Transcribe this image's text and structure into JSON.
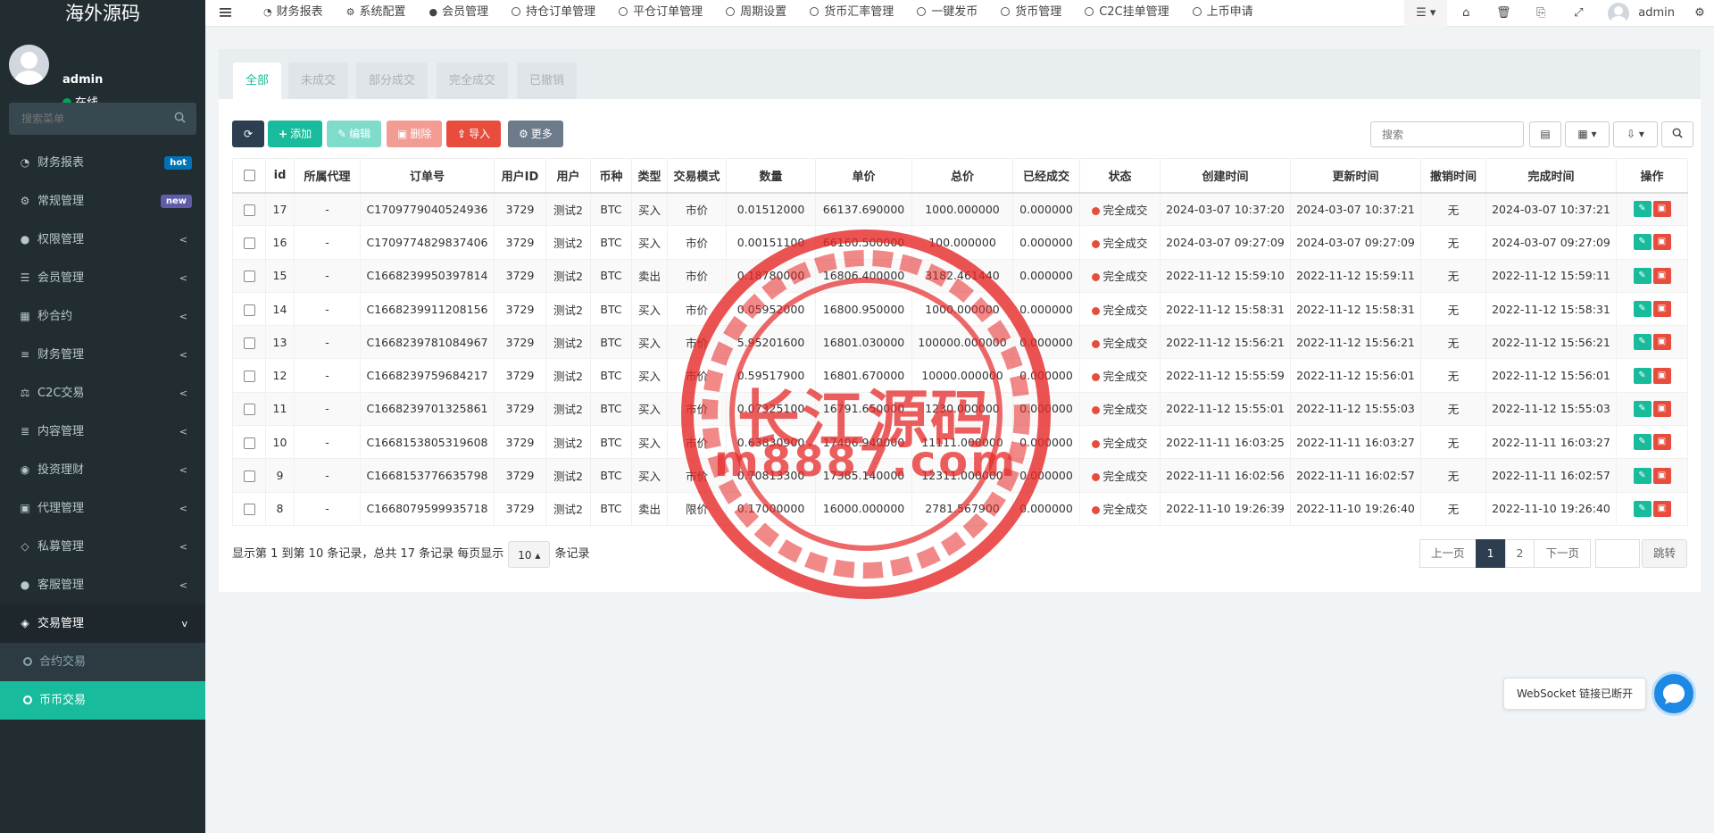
{
  "brand": "海外源码",
  "user": {
    "name": "admin",
    "status": "在线"
  },
  "sidebar": {
    "search_placeholder": "搜索菜单",
    "items": [
      {
        "label": "财务报表",
        "icon": "dashboard-icon",
        "badge": "hot"
      },
      {
        "label": "常规管理",
        "icon": "cogs-icon",
        "badge": "new"
      },
      {
        "label": "权限管理",
        "icon": "group-icon",
        "arrow": "<"
      },
      {
        "label": "会员管理",
        "icon": "list-icon",
        "arrow": "<"
      },
      {
        "label": "秒合约",
        "icon": "calendar-icon",
        "arrow": "<"
      },
      {
        "label": "财务管理",
        "icon": "database-icon",
        "arrow": "<"
      },
      {
        "label": "C2C交易",
        "icon": "balance-icon",
        "arrow": "<"
      },
      {
        "label": "内容管理",
        "icon": "align-left-icon",
        "arrow": "<"
      },
      {
        "label": "投资理财",
        "icon": "compass-icon",
        "arrow": "<"
      },
      {
        "label": "代理管理",
        "icon": "briefcase-icon",
        "arrow": "<"
      },
      {
        "label": "私募管理",
        "icon": "diamond-icon",
        "arrow": "<"
      },
      {
        "label": "客服管理",
        "icon": "comment-icon",
        "arrow": "<"
      },
      {
        "label": "交易管理",
        "icon": "handshake-icon",
        "arrow": "v"
      }
    ],
    "subitems": [
      {
        "label": "合约交易"
      },
      {
        "label": "币币交易"
      }
    ]
  },
  "header": {
    "tabs": [
      {
        "label": "财务报表",
        "icon": "dashboard-icon"
      },
      {
        "label": "系统配置",
        "icon": "gear-icon"
      },
      {
        "label": "会员管理",
        "icon": "user-icon"
      },
      {
        "label": "持仓订单管理",
        "icon": "circle-icon"
      },
      {
        "label": "平仓订单管理",
        "icon": "circle-icon"
      },
      {
        "label": "周期设置",
        "icon": "circle-icon"
      },
      {
        "label": "货币汇率管理",
        "icon": "circle-icon"
      },
      {
        "label": "一键发币",
        "icon": "circle-icon"
      },
      {
        "label": "货币管理",
        "icon": "circle-icon"
      },
      {
        "label": "C2C挂单管理",
        "icon": "circle-icon"
      },
      {
        "label": "上币申请",
        "icon": "circle-icon"
      }
    ],
    "user": "admin"
  },
  "filter_tabs": [
    "全部",
    "未成交",
    "部分成交",
    "完全成交",
    "已撤销"
  ],
  "toolbar": {
    "add": "添加",
    "edit": "编辑",
    "delete": "删除",
    "import": "导入",
    "more": "更多",
    "search_placeholder": "搜索"
  },
  "table": {
    "columns": [
      "id",
      "所属代理",
      "订单号",
      "用户ID",
      "用户",
      "币种",
      "类型",
      "交易模式",
      "数量",
      "单价",
      "总价",
      "已经成交",
      "状态",
      "创建时间",
      "更新时间",
      "撤销时间",
      "完成时间",
      "操作"
    ],
    "rows": [
      [
        "17",
        "-",
        "C1709779040524936",
        "3729",
        "测试2",
        "BTC",
        "买入",
        "市价",
        "0.01512000",
        "66137.690000",
        "1000.000000",
        "0.000000",
        "完全成交",
        "2024-03-07 10:37:20",
        "2024-03-07 10:37:21",
        "无",
        "2024-03-07 10:37:21"
      ],
      [
        "16",
        "-",
        "C1709774829837406",
        "3729",
        "测试2",
        "BTC",
        "买入",
        "市价",
        "0.00151100",
        "66160.500000",
        "100.000000",
        "0.000000",
        "完全成交",
        "2024-03-07 09:27:09",
        "2024-03-07 09:27:09",
        "无",
        "2024-03-07 09:27:09"
      ],
      [
        "15",
        "-",
        "C1668239950397814",
        "3729",
        "测试2",
        "BTC",
        "卖出",
        "市价",
        "0.18780000",
        "16806.400000",
        "3182.461440",
        "0.000000",
        "完全成交",
        "2022-11-12 15:59:10",
        "2022-11-12 15:59:11",
        "无",
        "2022-11-12 15:59:11"
      ],
      [
        "14",
        "-",
        "C1668239911208156",
        "3729",
        "测试2",
        "BTC",
        "买入",
        "市价",
        "0.05952000",
        "16800.950000",
        "1000.000000",
        "0.000000",
        "完全成交",
        "2022-11-12 15:58:31",
        "2022-11-12 15:58:31",
        "无",
        "2022-11-12 15:58:31"
      ],
      [
        "13",
        "-",
        "C1668239781084967",
        "3729",
        "测试2",
        "BTC",
        "买入",
        "市价",
        "5.95201600",
        "16801.030000",
        "100000.000000",
        "0.000000",
        "完全成交",
        "2022-11-12 15:56:21",
        "2022-11-12 15:56:21",
        "无",
        "2022-11-12 15:56:21"
      ],
      [
        "12",
        "-",
        "C1668239759684217",
        "3729",
        "测试2",
        "BTC",
        "买入",
        "市价",
        "0.59517900",
        "16801.670000",
        "10000.000000",
        "0.000000",
        "完全成交",
        "2022-11-12 15:55:59",
        "2022-11-12 15:56:01",
        "无",
        "2022-11-12 15:56:01"
      ],
      [
        "11",
        "-",
        "C1668239701325861",
        "3729",
        "测试2",
        "BTC",
        "买入",
        "市价",
        "0.07325100",
        "16791.650000",
        "1230.000000",
        "0.000000",
        "完全成交",
        "2022-11-12 15:55:01",
        "2022-11-12 15:55:03",
        "无",
        "2022-11-12 15:55:03"
      ],
      [
        "10",
        "-",
        "C1668153805319608",
        "3729",
        "测试2",
        "BTC",
        "买入",
        "市价",
        "0.63830900",
        "17406.940000",
        "11111.000000",
        "0.000000",
        "完全成交",
        "2022-11-11 16:03:25",
        "2022-11-11 16:03:27",
        "无",
        "2022-11-11 16:03:27"
      ],
      [
        "9",
        "-",
        "C1668153776635798",
        "3729",
        "测试2",
        "BTC",
        "买入",
        "市价",
        "0.70813300",
        "17385.140000",
        "12311.000000",
        "0.000000",
        "完全成交",
        "2022-11-11 16:02:56",
        "2022-11-11 16:02:57",
        "无",
        "2022-11-11 16:02:57"
      ],
      [
        "8",
        "-",
        "C1668079599935718",
        "3729",
        "测试2",
        "BTC",
        "卖出",
        "限价",
        "0.17000000",
        "16000.000000",
        "2781.567900",
        "0.000000",
        "完全成交",
        "2022-11-10 19:26:39",
        "2022-11-10 19:26:40",
        "无",
        "2022-11-10 19:26:40"
      ]
    ]
  },
  "pagination": {
    "info_prefix": "显示第 1 到第 10 条记录，总共 17 条记录 每页显示",
    "page_size": "10",
    "info_suffix": "条记录",
    "prev": "上一页",
    "pages": [
      "1",
      "2"
    ],
    "next": "下一页",
    "go": "跳转"
  },
  "watermark": {
    "line1": "长江源码",
    "line2": "m8887.com"
  },
  "websocket": {
    "message": "WebSocket 链接已断开"
  },
  "colors": {
    "primary": "#18bc9c",
    "danger": "#e74c3c",
    "sidebar": "#222d32",
    "dark": "#2c3e50"
  }
}
